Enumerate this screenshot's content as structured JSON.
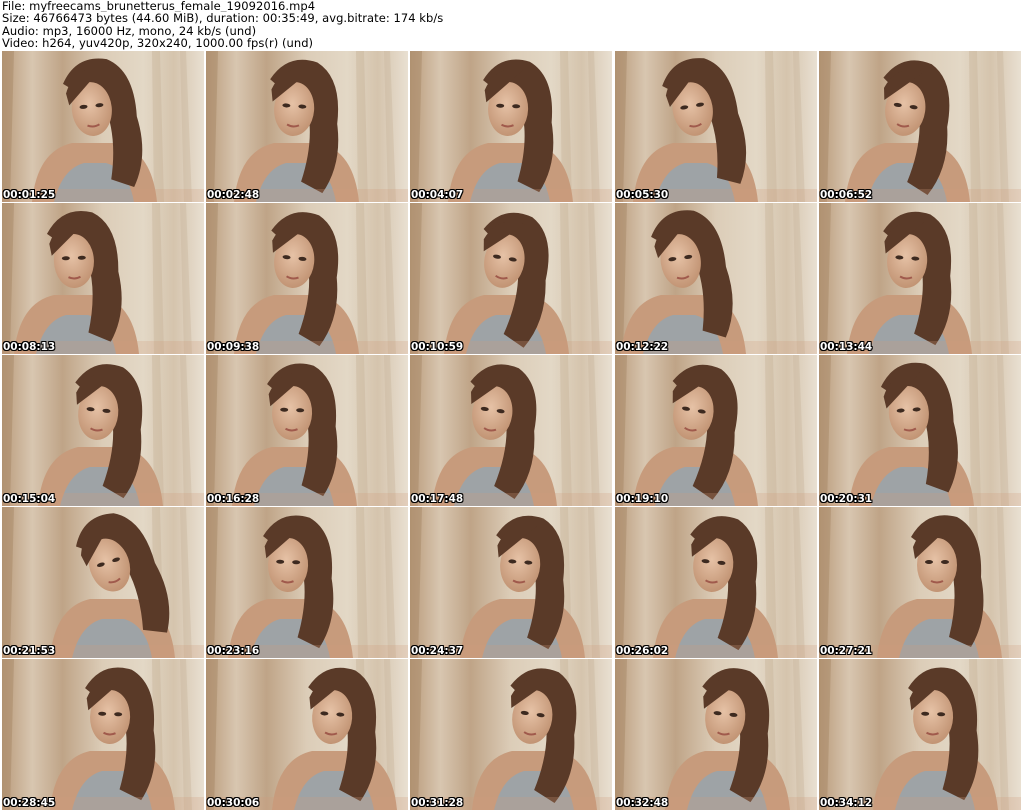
{
  "header": {
    "file_line": "File: myfreecams_brunetterus_female_19092016.mp4",
    "size_line": "Size: 46766473 bytes (44.60 MiB), duration: 00:35:49, avg.bitrate: 174 kb/s",
    "audio_line": "Audio: mp3, 16000 Hz, mono, 24 kb/s (und)",
    "video_line": "Video: h264, yuv420p, 320x240, 1000.00 fps(r) (und)"
  },
  "thumbnails": [
    {
      "timestamp": "00:01:25"
    },
    {
      "timestamp": "00:02:48"
    },
    {
      "timestamp": "00:04:07"
    },
    {
      "timestamp": "00:05:30"
    },
    {
      "timestamp": "00:06:52"
    },
    {
      "timestamp": "00:08:13"
    },
    {
      "timestamp": "00:09:38"
    },
    {
      "timestamp": "00:10:59"
    },
    {
      "timestamp": "00:12:22"
    },
    {
      "timestamp": "00:13:44"
    },
    {
      "timestamp": "00:15:04"
    },
    {
      "timestamp": "00:16:28"
    },
    {
      "timestamp": "00:17:48"
    },
    {
      "timestamp": "00:19:10"
    },
    {
      "timestamp": "00:20:31"
    },
    {
      "timestamp": "00:21:53"
    },
    {
      "timestamp": "00:23:16"
    },
    {
      "timestamp": "00:24:37"
    },
    {
      "timestamp": "00:26:02"
    },
    {
      "timestamp": "00:27:21"
    },
    {
      "timestamp": "00:28:45"
    },
    {
      "timestamp": "00:30:06"
    },
    {
      "timestamp": "00:31:28"
    },
    {
      "timestamp": "00:32:48"
    },
    {
      "timestamp": "00:34:12"
    }
  ]
}
